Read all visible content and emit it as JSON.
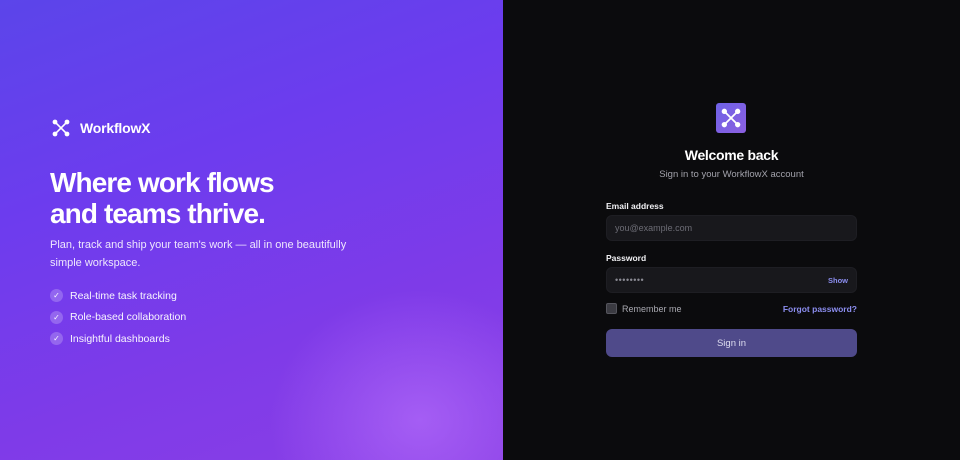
{
  "brand": {
    "name": "WorkflowX",
    "icon": "network-nodes-icon"
  },
  "hero": {
    "line1": "Where work flows",
    "line2": "and teams thrive.",
    "subtitle": "Plan, track and ship your team's work — all in one beautifully simple workspace."
  },
  "features": [
    {
      "label": "Real-time task tracking",
      "icon": "check-icon"
    },
    {
      "label": "Role-based collaboration",
      "icon": "check-icon"
    },
    {
      "label": "Insightful dashboards",
      "icon": "check-icon"
    }
  ],
  "login": {
    "title": "Welcome back",
    "subtitle": "Sign in to your WorkflowX account",
    "email_label": "Email address",
    "email_placeholder": "you@example.com",
    "email_value": "",
    "password_label": "Password",
    "password_masked": "••••••••",
    "show_label": "Show",
    "remember_label": "Remember me",
    "remember_checked": false,
    "forgot_label": "Forgot password?",
    "submit_label": "Sign in"
  },
  "colors": {
    "accent": "#8c8ef0",
    "button": "#4f4a8a",
    "left_gradient_start": "#5b45ea",
    "left_gradient_end": "#8a3fe6",
    "panel_bg": "#0b0b0d"
  }
}
